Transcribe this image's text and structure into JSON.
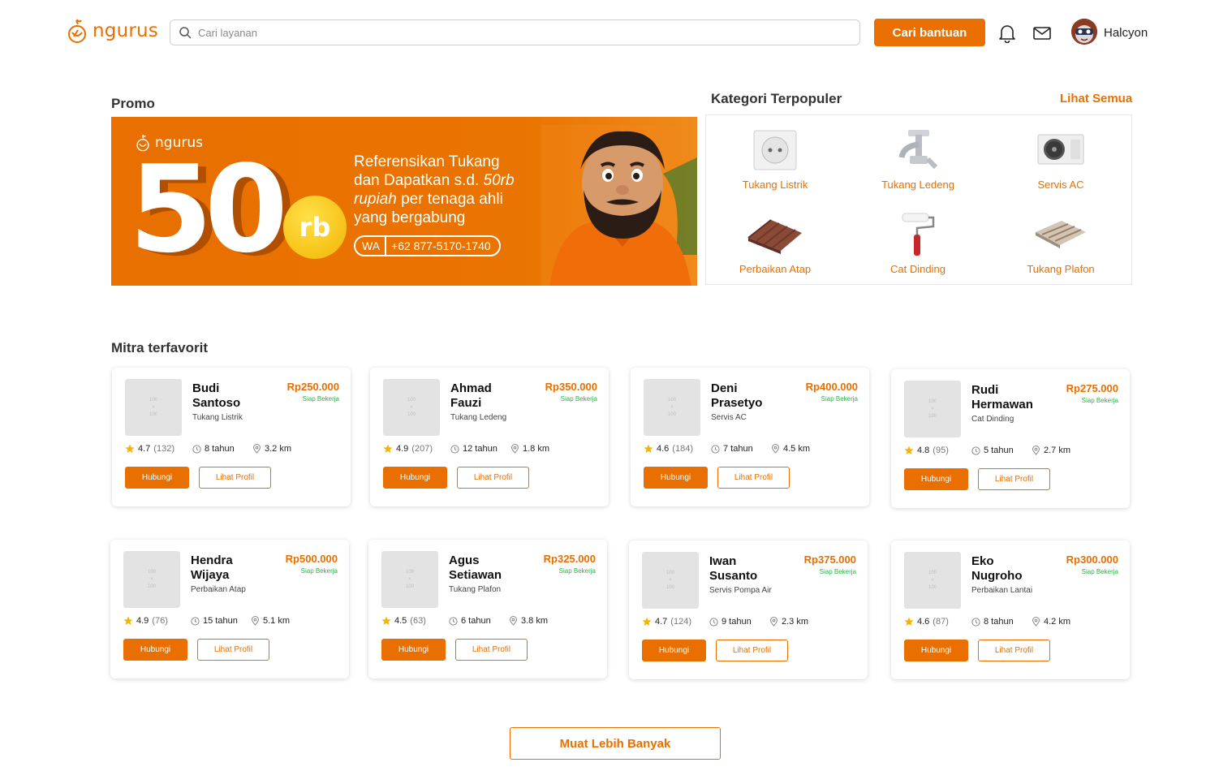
{
  "header": {
    "brand": "ngurus",
    "search_placeholder": "Cari layanan",
    "search_button": "Cari bantuan",
    "user_name": "Halcyon"
  },
  "promo": {
    "section_title": "Promo",
    "banner_brand": "ngurus",
    "big_number": "50",
    "unit": "rb",
    "headline_line1": "Referensikan Tukang",
    "headline_line2_prefix": "dan Dapatkan s.d. ",
    "headline_line2_em": "50rb",
    "headline_line3_em": "rupiah",
    "headline_line3_suffix": " per tenaga ahli",
    "headline_line4": "yang bergabung",
    "wa_label": "WA",
    "wa_number": "+62 877-5170-1740"
  },
  "kategori": {
    "title": "Kategori Terpopuler",
    "see_all": "Lihat Semua",
    "items": [
      {
        "label": "Tukang Listrik",
        "icon": "power-outlet-icon"
      },
      {
        "label": "Tukang Ledeng",
        "icon": "faucet-icon"
      },
      {
        "label": "Servis AC",
        "icon": "ac-unit-icon"
      },
      {
        "label": "Perbaikan Atap",
        "icon": "roof-icon"
      },
      {
        "label": "Cat Dinding",
        "icon": "paint-roller-icon"
      },
      {
        "label": "Tukang Plafon",
        "icon": "ceiling-panel-icon"
      }
    ]
  },
  "mitra": {
    "title": "Mitra terfavorit",
    "status_label": "Siap Bekerja",
    "thumb_placeholder": [
      "100",
      "×",
      "100"
    ],
    "contact_label": "Hubungi",
    "profile_label": "Lihat Profil",
    "cards": [
      {
        "first": "Budi",
        "last": "Santoso",
        "role": "Tukang Listrik",
        "price": "Rp250.000",
        "rating": "4.7",
        "reviews": "(132)",
        "experience": "8 tahun",
        "distance": "3.2 km"
      },
      {
        "first": "Ahmad",
        "last": "Fauzi",
        "role": "Tukang Ledeng",
        "price": "Rp350.000",
        "rating": "4.9",
        "reviews": "(207)",
        "experience": "12 tahun",
        "distance": "1.8 km"
      },
      {
        "first": "Deni",
        "last": "Prasetyo",
        "role": "Servis AC",
        "price": "Rp400.000",
        "rating": "4.6",
        "reviews": "(184)",
        "experience": "7 tahun",
        "distance": "4.5 km"
      },
      {
        "first": "Rudi",
        "last": "Hermawan",
        "role": "Cat Dinding",
        "price": "Rp275.000",
        "rating": "4.8",
        "reviews": "(95)",
        "experience": "5 tahun",
        "distance": "2.7 km"
      },
      {
        "first": "Hendra",
        "last": "Wijaya",
        "role": "Perbaikan Atap",
        "price": "Rp500.000",
        "rating": "4.9",
        "reviews": "(76)",
        "experience": "15 tahun",
        "distance": "5.1 km"
      },
      {
        "first": "Agus",
        "last": "Setiawan",
        "role": "Tukang Plafon",
        "price": "Rp325.000",
        "rating": "4.5",
        "reviews": "(63)",
        "experience": "6 tahun",
        "distance": "3.8 km"
      },
      {
        "first": "Iwan",
        "last": "Susanto",
        "role": "Servis Pompa Air",
        "price": "Rp375.000",
        "rating": "4.7",
        "reviews": "(124)",
        "experience": "9 tahun",
        "distance": "2.3 km"
      },
      {
        "first": "Eko",
        "last": "Nugroho",
        "role": "Perbaikan Lantai",
        "price": "Rp300.000",
        "rating": "4.6",
        "reviews": "(87)",
        "experience": "8 tahun",
        "distance": "4.2 km"
      }
    ],
    "load_more": "Muat Lebih Banyak"
  },
  "colors": {
    "brand": "#e86f00",
    "status_green": "#2cb24a",
    "star": "#f5b400"
  }
}
